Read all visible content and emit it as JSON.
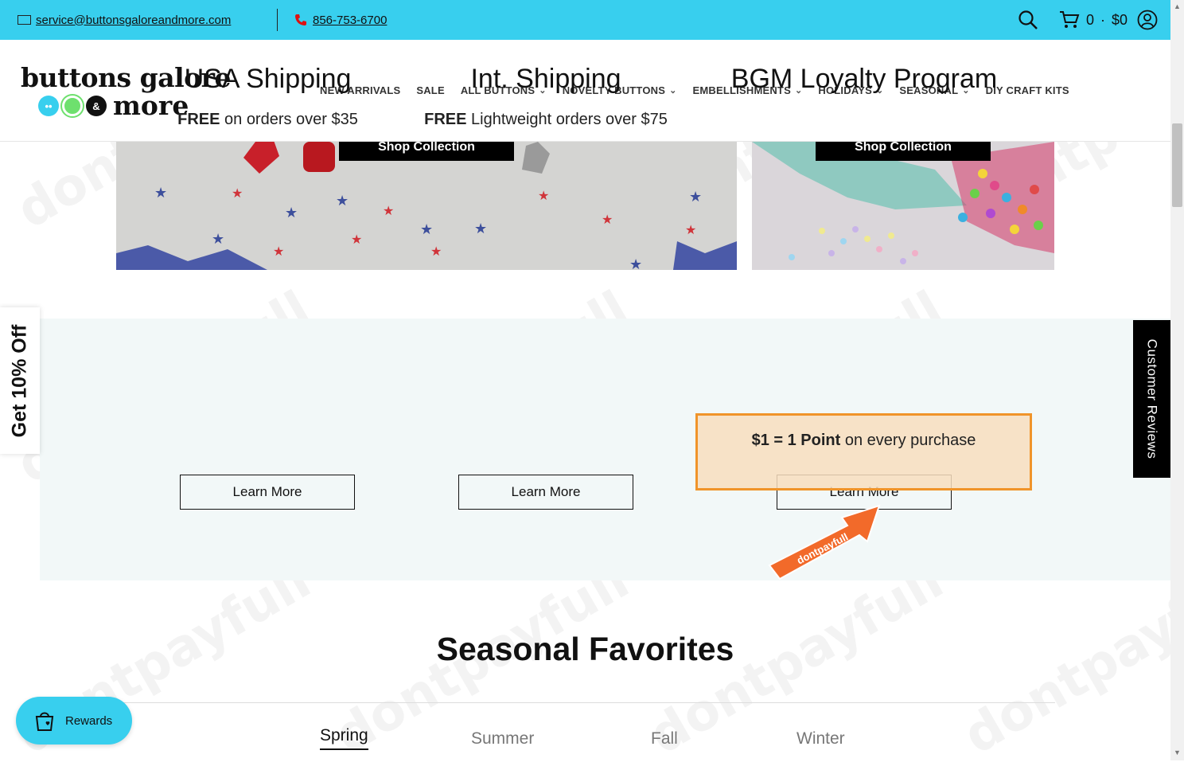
{
  "topbar": {
    "email": "service@buttonsgaloreandmore.com",
    "phone": "856-753-6700",
    "cart_count": "0",
    "cart_separator": "·",
    "cart_total": "$0",
    "icons": [
      "mail-icon",
      "phone-icon",
      "search-icon",
      "cart-icon",
      "account-icon"
    ]
  },
  "logo": {
    "line1": "buttons galore",
    "ampersand": "&",
    "line2": "more",
    "dot_colors": [
      "#38cfee",
      "#6ee06e",
      "#111111"
    ]
  },
  "nav": {
    "items": [
      {
        "label": "NEW ARRIVALS",
        "dropdown": false
      },
      {
        "label": "SALE",
        "dropdown": false
      },
      {
        "label": "ALL BUTTONS",
        "dropdown": true
      },
      {
        "label": "NOVELTY BUTTONS",
        "dropdown": true
      },
      {
        "label": "EMBELLISHMENTS",
        "dropdown": true
      },
      {
        "label": "HOLIDAYS",
        "dropdown": true
      },
      {
        "label": "SEASONAL",
        "dropdown": true
      },
      {
        "label": "DIY CRAFT KITS",
        "dropdown": false
      }
    ],
    "chevron": "⌄"
  },
  "banners": [
    {
      "button_label": "Shop Collection"
    },
    {
      "button_label": "Shop Collection"
    }
  ],
  "features": [
    {
      "title": "USA Shipping",
      "bold": "FREE",
      "text": " on orders over $35",
      "button": "Learn More"
    },
    {
      "title": "Int. Shipping",
      "bold": "FREE",
      "text": " Lightweight orders over $75",
      "button": "Learn More"
    },
    {
      "title": "BGM Loyalty Program",
      "bold": "$1 = 1 Point",
      "text": " on every purchase",
      "button": "Learn More"
    }
  ],
  "side_tab": {
    "label": "Get 10% Off"
  },
  "reviews_tab": {
    "label": "Customer Reviews"
  },
  "seasonal": {
    "title": "Seasonal Favorites",
    "tabs": [
      "Spring",
      "Summer",
      "Fall",
      "Winter"
    ],
    "active_tab": "Spring"
  },
  "rewards": {
    "label": "Rewards"
  },
  "watermark": {
    "text": "dontpayfull"
  },
  "colors": {
    "accent": "#38cfee",
    "highlight_border": "#f0942a",
    "arrow": "#f26a2a"
  }
}
